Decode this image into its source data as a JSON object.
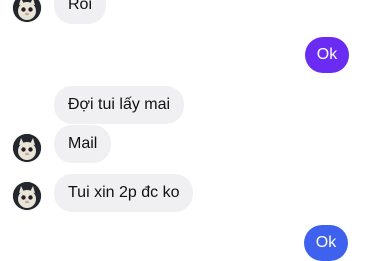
{
  "messages": [
    {
      "direction": "incoming",
      "text": "Rồi",
      "has_avatar": true
    },
    {
      "direction": "outgoing",
      "text": "Ok",
      "color": "#6a2cf2"
    },
    {
      "direction": "incoming",
      "text": "Đợi tui lấy mai",
      "has_avatar": false
    },
    {
      "direction": "incoming",
      "text": "Mail",
      "has_avatar": true
    },
    {
      "direction": "incoming",
      "text": "Tui xin 2p đc ko",
      "has_avatar": true
    },
    {
      "direction": "outgoing",
      "text": "Ok",
      "color": "#3f62ee"
    }
  ],
  "colors": {
    "incoming_bubble": "#f0f0f2",
    "outgoing_bubble_top": "#6a2cf2",
    "outgoing_bubble_bottom": "#3f62ee"
  },
  "icons": {
    "avatar": "cat-avatar-icon"
  }
}
